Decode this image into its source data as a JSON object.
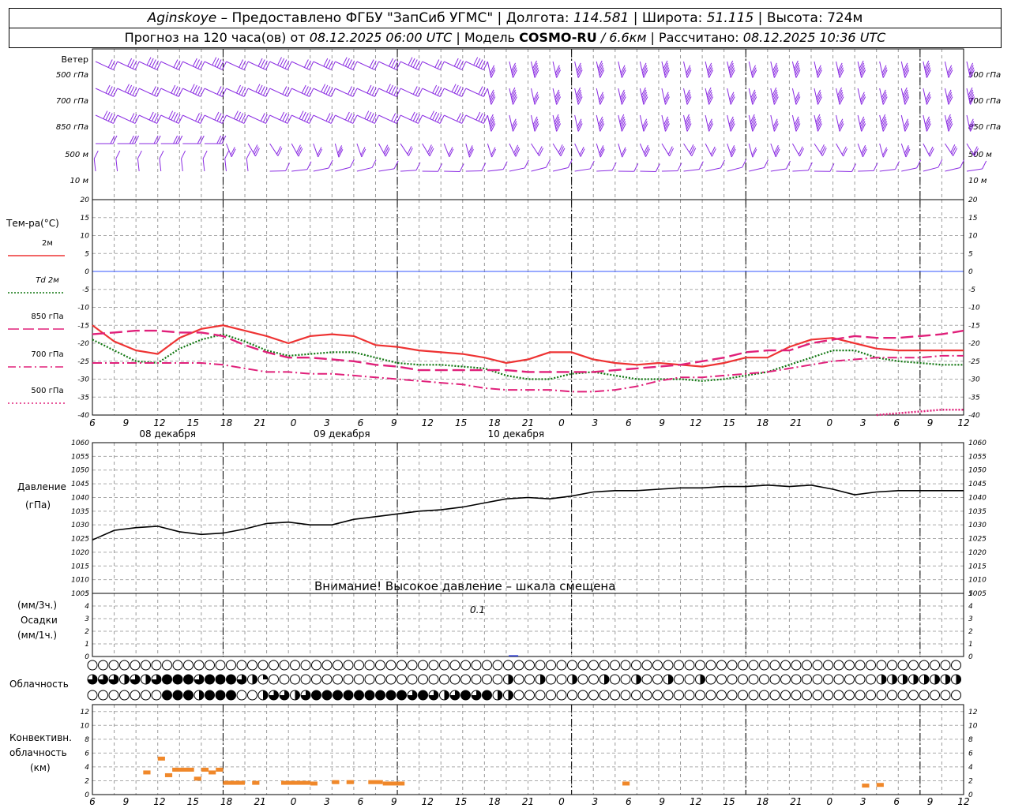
{
  "header": {
    "station": "Aginskoye",
    "provider": "– Предоставлено ФГБУ \"ЗапСиб УГМС\"",
    "lon_label": "Долгота:",
    "lon_value": "114.581",
    "lat_label": "Широта:",
    "lat_value": "51.115",
    "alt_label": "Высота:",
    "alt_value": "724м",
    "forecast_prefix": "Прогноз на 120 часа(ов) от",
    "forecast_time": "08.12.2025 06:00 UTC",
    "model_label": "Модель",
    "model_name": "COSMO-RU",
    "model_res": "/ 6.6км",
    "calc_label": "Рассчитано:",
    "calc_time": "08.12.2025 10:36 UTC"
  },
  "wind_panel": {
    "title": "Ветер",
    "levels": [
      "500 гПа",
      "700 гПа",
      "850 гПа",
      "500 м",
      "10  м"
    ]
  },
  "temp_panel": {
    "title": "Тем-ра(°C)",
    "legend": [
      {
        "label": "2м",
        "color": "#ee3333",
        "dash": "solid"
      },
      {
        "label": "Td  2м",
        "color": "#117711",
        "dash": "dotted"
      },
      {
        "label": "850 гПа",
        "color": "#e0207a",
        "dash": "dash"
      },
      {
        "label": "700 гПа",
        "color": "#e0207a",
        "dash": "dashdot"
      },
      {
        "label": "500 гПа",
        "color": "#e0207a",
        "dash": "dots"
      }
    ],
    "x_hours": [
      "6",
      "9",
      "12",
      "15",
      "18",
      "21",
      "0",
      "3",
      "6",
      "9",
      "12",
      "15",
      "18",
      "21",
      "0",
      "3",
      "6",
      "9",
      "12",
      "15",
      "18",
      "21",
      "0",
      "3",
      "6",
      "9",
      "12"
    ],
    "dates": [
      "08 декабря",
      "09 декабря",
      "10 декабря"
    ]
  },
  "pressure_panel": {
    "title": "Давление",
    "unit": "(гПа)",
    "warning": "Внимание! Высокое давление – шкала смещена"
  },
  "precip_panel": {
    "unit3": "(мм/3ч.)",
    "title": "Осадки",
    "unit1": "(мм/1ч.)",
    "label": "0.1"
  },
  "cloud_panel": {
    "title": "Облачность"
  },
  "conv_panel": {
    "title1": "Конвективн.",
    "title2": "облачность",
    "unit": "(км)"
  },
  "colors": {
    "wind": "#8a2be2",
    "t2m": "#ee3333",
    "td": "#117711",
    "p850": "#e0207a",
    "p700": "#e0207a",
    "p500": "#e0207a",
    "pressure": "#000000",
    "conv": "#f0882a",
    "zero": "#3355ff"
  },
  "chart_data": [
    {
      "type": "line",
      "title": "Тем-ра(°C)",
      "x_hours_since_start": [
        0,
        3,
        6,
        9,
        12,
        15,
        18,
        21,
        24,
        27,
        30,
        33,
        36,
        39,
        42,
        45,
        48,
        51,
        54,
        57,
        60,
        63,
        66,
        69,
        72,
        75,
        78,
        81,
        84,
        87,
        90,
        93,
        96,
        99,
        102,
        105,
        108,
        111,
        114,
        117,
        120
      ],
      "ylim": [
        -40,
        20
      ],
      "yticks": [
        -40,
        -35,
        -30,
        -25,
        -20,
        -15,
        -10,
        -5,
        0,
        5,
        10,
        15,
        20
      ],
      "series": [
        {
          "name": "2м",
          "values": [
            -15,
            -19.5,
            -22,
            -23,
            -18.5,
            -16,
            -15,
            -16.5,
            -18,
            -20,
            -18,
            -17.5,
            -18,
            -20.5,
            -21,
            -22,
            -22.5,
            -23,
            -24,
            -25.5,
            -24.5,
            -22.5,
            -22.5,
            -24.5,
            -25.5,
            -26,
            -25.5,
            -26,
            -26.5,
            -25.5,
            -24,
            -24,
            -21,
            -19,
            -18.5,
            -20,
            -21.5,
            -22,
            -22,
            -22,
            -22
          ]
        },
        {
          "name": "Td  2м",
          "values": [
            -19,
            -22,
            -25,
            -25.5,
            -21.5,
            -19,
            -17.5,
            -19.5,
            -22,
            -23.5,
            -23,
            -22.5,
            -22.5,
            -24,
            -25.5,
            -26,
            -26,
            -26.5,
            -27,
            -29,
            -30,
            -30,
            -28.5,
            -28,
            -29,
            -30,
            -30,
            -30,
            -30.5,
            -30,
            -29,
            -28,
            -26,
            -24,
            -22,
            -22,
            -24,
            -25,
            -25.5,
            -26,
            -26
          ]
        },
        {
          "name": "850 гПа",
          "values": [
            -17.5,
            -17,
            -16.5,
            -16.5,
            -17,
            -17,
            -18,
            -20.5,
            -22.5,
            -24,
            -24,
            -24.5,
            -25,
            -26,
            -26.5,
            -27.5,
            -27.5,
            -27.5,
            -27.5,
            -27.5,
            -28,
            -28,
            -28,
            -28,
            -27.5,
            -27,
            -26.5,
            -26,
            -25,
            -24,
            -22.5,
            -22,
            -22,
            -20,
            -19,
            -18,
            -18.5,
            -18.5,
            -18,
            -17.5,
            -16.5
          ]
        },
        {
          "name": "700 гПа",
          "values": [
            -25.5,
            -25.5,
            -25.5,
            -25.5,
            -25.5,
            -25.5,
            -26,
            -27,
            -28,
            -28,
            -28.5,
            -28.5,
            -29,
            -29.5,
            -30,
            -30.5,
            -31,
            -31.5,
            -32.5,
            -33,
            -33,
            -33,
            -33.5,
            -33.5,
            -33,
            -32,
            -30.5,
            -29.5,
            -29.5,
            -29,
            -28.5,
            -28,
            -27,
            -26,
            -25,
            -24.5,
            -24,
            -24,
            -24,
            -23.5,
            -23.5
          ]
        },
        {
          "name": "500 гПа",
          "values": [
            null,
            null,
            null,
            null,
            null,
            null,
            null,
            null,
            null,
            null,
            null,
            null,
            null,
            null,
            null,
            null,
            null,
            null,
            null,
            null,
            null,
            null,
            null,
            null,
            null,
            null,
            null,
            null,
            null,
            null,
            null,
            null,
            null,
            null,
            null,
            null,
            -40,
            -39.5,
            -39,
            -38.5,
            -38.5
          ]
        }
      ]
    },
    {
      "type": "line",
      "title": "Давление",
      "ylabel": "(гПа)",
      "x_hours_since_start": [
        0,
        3,
        6,
        9,
        12,
        15,
        18,
        21,
        24,
        27,
        30,
        33,
        36,
        39,
        42,
        45,
        48,
        51,
        54,
        57,
        60,
        63,
        66,
        69,
        72,
        75,
        78,
        81,
        84,
        87,
        90,
        93,
        96,
        99,
        102,
        105,
        108,
        111,
        114,
        117,
        120
      ],
      "ylim": [
        1005,
        1060
      ],
      "yticks": [
        1005,
        1010,
        1015,
        1020,
        1025,
        1030,
        1035,
        1040,
        1045,
        1050,
        1055,
        1060
      ],
      "series": [
        {
          "name": "Давление",
          "values": [
            1024.5,
            1028,
            1029,
            1029.5,
            1027.5,
            1026.5,
            1027,
            1028.5,
            1030.5,
            1031,
            1030,
            1030,
            1032,
            1033,
            1034,
            1035,
            1035.5,
            1036.5,
            1038,
            1039.5,
            1040,
            1039.5,
            1040.5,
            1042,
            1042.5,
            1042.5,
            1043,
            1043.5,
            1043.5,
            1044,
            1044,
            1044.5,
            1044,
            1044.5,
            1043,
            1041,
            1042,
            1042.5,
            1042.5,
            1042.5,
            1042.5
          ]
        }
      ]
    },
    {
      "type": "bar",
      "title": "Осадки",
      "ylim": [
        0,
        5
      ],
      "yticks": [
        0,
        1,
        2,
        3,
        4,
        5
      ],
      "x_hours_since_start": [
        58
      ],
      "values": [
        0.1
      ]
    },
    {
      "type": "bar",
      "title": "Конвективн. облачность",
      "ylabel": "(км)",
      "ylim": [
        0,
        13
      ],
      "yticks": [
        0,
        2,
        4,
        6,
        8,
        10,
        12
      ],
      "segments": [
        {
          "x": [
            7,
            8
          ],
          "y": 3.2
        },
        {
          "x": [
            9,
            10
          ],
          "y": 5.2
        },
        {
          "x": [
            10,
            11
          ],
          "y": 2.8
        },
        {
          "x": [
            11,
            14
          ],
          "y": 3.6
        },
        {
          "x": [
            14,
            15
          ],
          "y": 2.3
        },
        {
          "x": [
            15,
            16
          ],
          "y": 3.6
        },
        {
          "x": [
            16,
            17
          ],
          "y": 3.2
        },
        {
          "x": [
            17,
            18
          ],
          "y": 3.6
        },
        {
          "x": [
            18,
            21
          ],
          "y": 1.7
        },
        {
          "x": [
            22,
            23
          ],
          "y": 1.7
        },
        {
          "x": [
            26,
            30
          ],
          "y": 1.7
        },
        {
          "x": [
            30,
            31
          ],
          "y": 1.6
        },
        {
          "x": [
            33,
            34
          ],
          "y": 1.8
        },
        {
          "x": [
            35,
            36
          ],
          "y": 1.8
        },
        {
          "x": [
            38,
            40
          ],
          "y": 1.8
        },
        {
          "x": [
            40,
            42
          ],
          "y": 1.6
        },
        {
          "x": [
            42,
            43
          ],
          "y": 1.6
        },
        {
          "x": [
            73,
            74
          ],
          "y": 1.6
        },
        {
          "x": [
            106,
            107
          ],
          "y": 1.3
        },
        {
          "x": [
            108,
            109
          ],
          "y": 1.4
        }
      ]
    }
  ]
}
